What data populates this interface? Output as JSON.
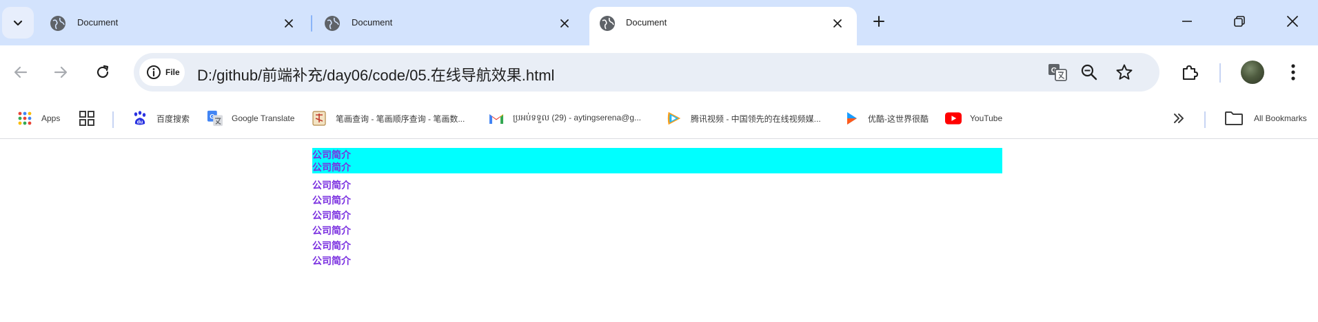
{
  "browser": {
    "tabs": [
      {
        "title": "Document",
        "active": false
      },
      {
        "title": "Document",
        "active": false
      },
      {
        "title": "Document",
        "active": true
      }
    ],
    "url_chip_label": "File",
    "url": "D:/github/前端补充/day06/code/05.在线导航效果.html"
  },
  "bookmarks": {
    "items": [
      {
        "label": "Apps",
        "icon": "apps-grid-icon"
      },
      {
        "label": "",
        "icon": "tab-groups-icon"
      },
      {
        "label": "百度搜索",
        "icon": "baidu-icon"
      },
      {
        "label": "Google Translate",
        "icon": "google-translate-icon"
      },
      {
        "label": "笔画查询 - 笔画顺序查询 - 笔画数...",
        "icon": "stroke-order-icon"
      },
      {
        "label": "ប្រអប់ទទួល (29) - aytingserena@g...",
        "icon": "gmail-icon"
      },
      {
        "label": "腾讯视频 - 中国领先的在线视频媒...",
        "icon": "tencent-video-icon"
      },
      {
        "label": "优酷-这世界很酷",
        "icon": "youku-icon"
      },
      {
        "label": "YouTube",
        "icon": "youtube-icon"
      }
    ],
    "all_bookmarks_label": "All Bookmarks"
  },
  "page": {
    "nav_items": [
      "公司简介",
      "公司简介",
      "公司简介",
      "公司简介",
      "公司简介",
      "公司简介",
      "公司简介",
      "公司简介"
    ],
    "hover_index": 0,
    "colors": {
      "link": "#7a2fe0",
      "hover_bg": "#00ffff"
    }
  }
}
